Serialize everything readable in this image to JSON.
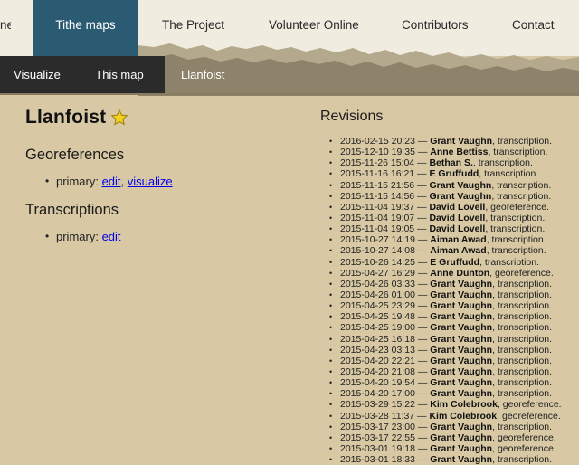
{
  "topnav": {
    "items": [
      {
        "label": "ne",
        "active": false
      },
      {
        "label": "Tithe maps",
        "active": true
      },
      {
        "label": "The Project",
        "active": false
      },
      {
        "label": "Volunteer Online",
        "active": false
      },
      {
        "label": "Contributors",
        "active": false
      },
      {
        "label": "Contact",
        "active": false
      }
    ]
  },
  "subnav": {
    "visualize": "Visualize",
    "this_map": "This map",
    "current": "Llanfoist"
  },
  "page": {
    "title": "Llanfoist",
    "star_icon": "star-icon",
    "georeferences": {
      "heading": "Georeferences",
      "item_prefix": "primary:",
      "edit_label": "edit",
      "separator": ",",
      "visualize_label": "visualize"
    },
    "transcriptions": {
      "heading": "Transcriptions",
      "item_prefix": "primary:",
      "edit_label": "edit"
    }
  },
  "revisions": {
    "heading": "Revisions",
    "items": [
      {
        "time": "2016-02-15 20:23",
        "user": "Grant Vaughn",
        "type": "transcription."
      },
      {
        "time": "2015-12-10 19:35",
        "user": "Anne Bettiss",
        "type": "transcription."
      },
      {
        "time": "2015-11-26 15:04",
        "user": "Bethan S.",
        "type": "transcription."
      },
      {
        "time": "2015-11-16 16:21",
        "user": "E Gruffudd",
        "type": "transcription."
      },
      {
        "time": "2015-11-15 21:56",
        "user": "Grant Vaughn",
        "type": "transcription."
      },
      {
        "time": "2015-11-15 14:56",
        "user": "Grant Vaughn",
        "type": "transcription."
      },
      {
        "time": "2015-11-04 19:37",
        "user": "David Lovell",
        "type": "georeference."
      },
      {
        "time": "2015-11-04 19:07",
        "user": "David Lovell",
        "type": "transcription."
      },
      {
        "time": "2015-11-04 19:05",
        "user": "David Lovell",
        "type": "transcription."
      },
      {
        "time": "2015-10-27 14:19",
        "user": "Aiman Awad",
        "type": "transcription."
      },
      {
        "time": "2015-10-27 14:08",
        "user": "Aiman Awad",
        "type": "transcription."
      },
      {
        "time": "2015-10-26 14:25",
        "user": "E Gruffudd",
        "type": "transcription."
      },
      {
        "time": "2015-04-27 16:29",
        "user": "Anne Dunton",
        "type": "georeference."
      },
      {
        "time": "2015-04-26 03:33",
        "user": "Grant Vaughn",
        "type": "transcription."
      },
      {
        "time": "2015-04-26 01:00",
        "user": "Grant Vaughn",
        "type": "transcription."
      },
      {
        "time": "2015-04-25 23:29",
        "user": "Grant Vaughn",
        "type": "transcription."
      },
      {
        "time": "2015-04-25 19:48",
        "user": "Grant Vaughn",
        "type": "transcription."
      },
      {
        "time": "2015-04-25 19:00",
        "user": "Grant Vaughn",
        "type": "transcription."
      },
      {
        "time": "2015-04-25 16:18",
        "user": "Grant Vaughn",
        "type": "transcription."
      },
      {
        "time": "2015-04-23 03:13",
        "user": "Grant Vaughn",
        "type": "transcription."
      },
      {
        "time": "2015-04-20 22:21",
        "user": "Grant Vaughn",
        "type": "transcription."
      },
      {
        "time": "2015-04-20 21:08",
        "user": "Grant Vaughn",
        "type": "transcription."
      },
      {
        "time": "2015-04-20 19:54",
        "user": "Grant Vaughn",
        "type": "transcription."
      },
      {
        "time": "2015-04-20 17:00",
        "user": "Grant Vaughn",
        "type": "transcription."
      },
      {
        "time": "2015-03-29 15:22",
        "user": "Kim Colebrook",
        "type": "georeference."
      },
      {
        "time": "2015-03-28 11:37",
        "user": "Kim Colebrook",
        "type": "georeference."
      },
      {
        "time": "2015-03-17 23:00",
        "user": "Grant Vaughn",
        "type": "transcription."
      },
      {
        "time": "2015-03-17 22:55",
        "user": "Grant Vaughn",
        "type": "georeference."
      },
      {
        "time": "2015-03-01 19:18",
        "user": "Grant Vaughn",
        "type": "georeference."
      },
      {
        "time": "2015-03-01 18:33",
        "user": "Grant Vaughn",
        "type": "transcription."
      }
    ]
  },
  "colors": {
    "page_bg": "#d8c9a4",
    "nav_bg": "#f1ece0",
    "active_tab": "#2b5b73",
    "subnav_dark": "#2b2b2b",
    "link": "#0000ee",
    "star": "#f2d21b"
  }
}
